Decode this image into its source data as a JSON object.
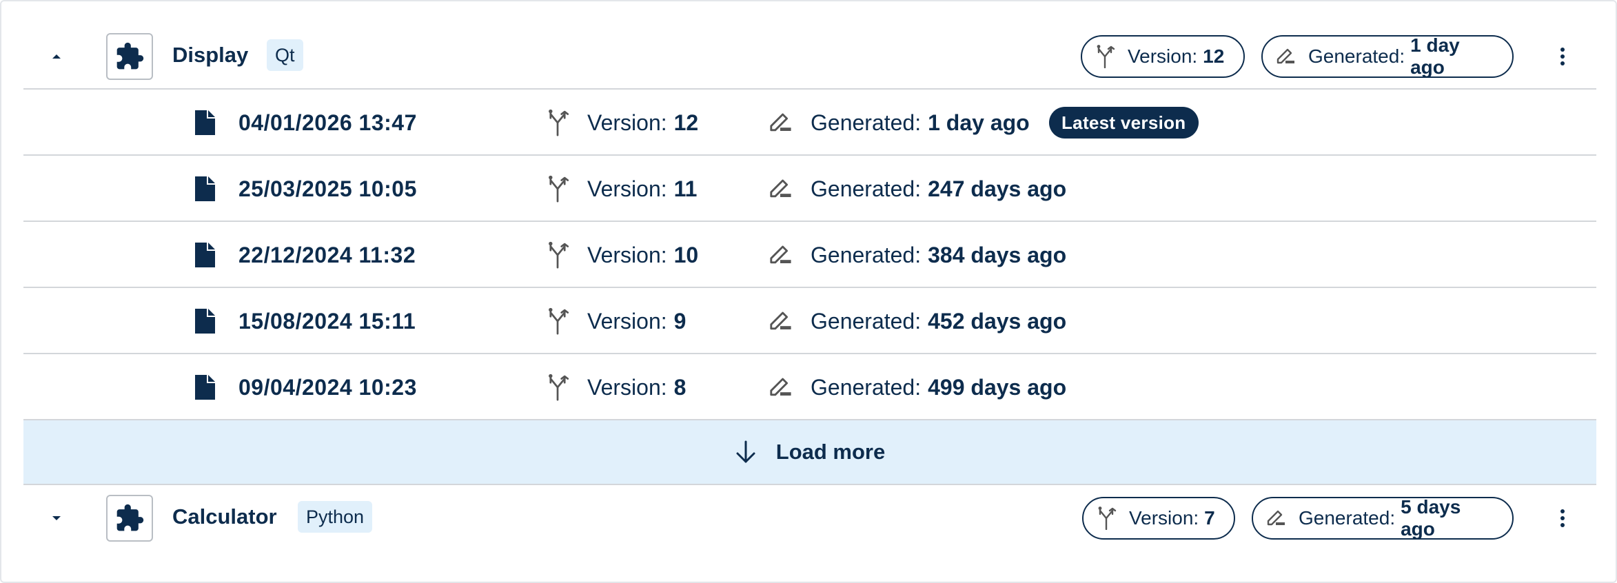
{
  "components": [
    {
      "name": "Display",
      "tag": "Qt",
      "expanded": true,
      "version_label": "Version:",
      "version": "12",
      "generated_label": "Generated:",
      "generated": "1 day ago",
      "versions": [
        {
          "date": "04/01/2026 13:47",
          "version": "12",
          "generated": "1 day ago",
          "badge": "Latest version"
        },
        {
          "date": "25/03/2025 10:05",
          "version": "11",
          "generated": "247 days ago"
        },
        {
          "date": "22/12/2024 11:32",
          "version": "10",
          "generated": "384 days ago"
        },
        {
          "date": "15/08/2024 15:11",
          "version": "9",
          "generated": "452 days ago"
        },
        {
          "date": "09/04/2024 10:23",
          "version": "8",
          "generated": "499 days ago"
        }
      ],
      "load_more": "Load more"
    },
    {
      "name": "Calculator",
      "tag": "Python",
      "expanded": false,
      "version_label": "Version:",
      "version": "7",
      "generated_label": "Generated:",
      "generated": "5 days ago"
    }
  ],
  "labels": {
    "version": "Version:",
    "generated": "Generated:"
  },
  "icons": {
    "component": "puzzle-icon",
    "file": "file-icon",
    "version": "merge-icon",
    "generated": "edit-icon",
    "load_more": "arrow-down-icon",
    "menu": "kebab-icon",
    "collapse": "caret-up-icon",
    "expand": "caret-down-icon"
  },
  "colors": {
    "primary": "#0d2c4d",
    "tag_bg": "#e1f0fb",
    "border": "#d3d6da"
  }
}
